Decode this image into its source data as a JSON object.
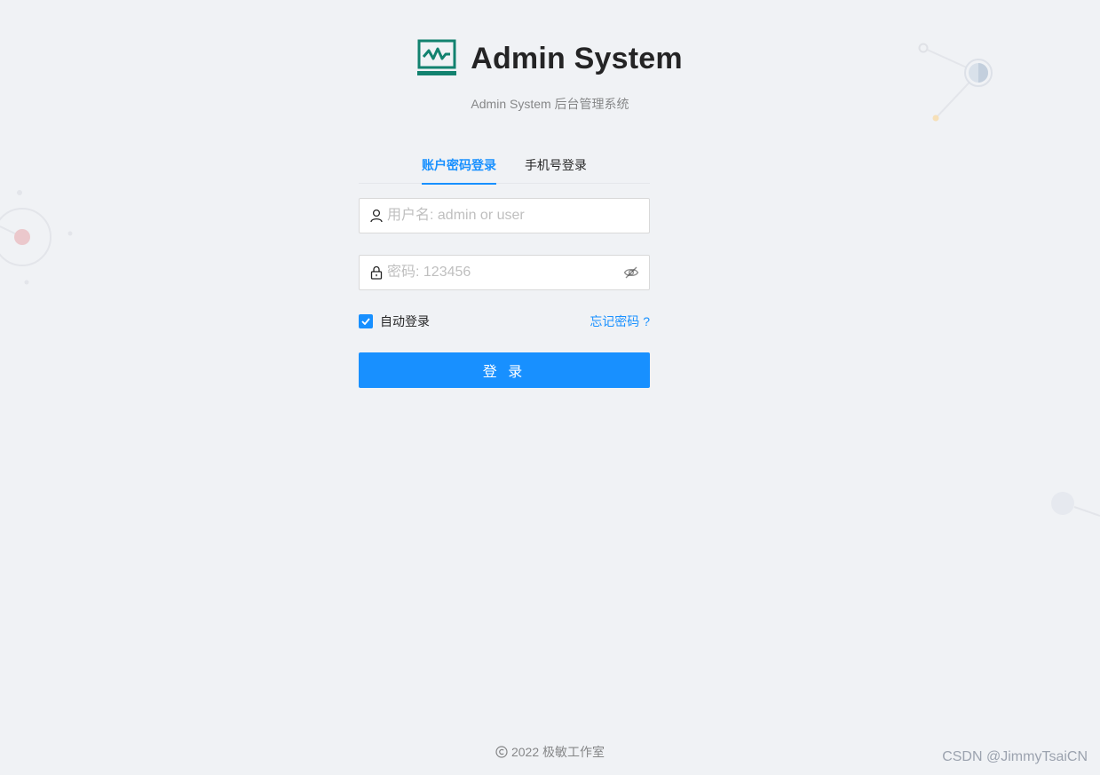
{
  "brand": {
    "title": "Admin System",
    "subtitle": "Admin System 后台管理系统",
    "logo_icon": "activity-monitor-icon",
    "logo_color": "#12826f"
  },
  "tabs": [
    {
      "label": "账户密码登录",
      "active": true
    },
    {
      "label": "手机号登录",
      "active": false
    }
  ],
  "form": {
    "username": {
      "value": "",
      "placeholder": "用户名: admin or user",
      "icon": "user-icon"
    },
    "password": {
      "value": "",
      "placeholder": "密码: 123456",
      "icon": "lock-icon",
      "toggle_icon": "eye-invisible-icon"
    },
    "remember": {
      "label": "自动登录",
      "checked": true
    },
    "forgot_label": "忘记密码 ?",
    "submit_label": "登 录"
  },
  "footer": {
    "copyright_icon": "copyright-icon",
    "text": "2022 极敏工作室"
  },
  "watermark": "CSDN @JimmyTsaiCN",
  "colors": {
    "primary": "#1890ff",
    "background": "#f0f2f5"
  }
}
